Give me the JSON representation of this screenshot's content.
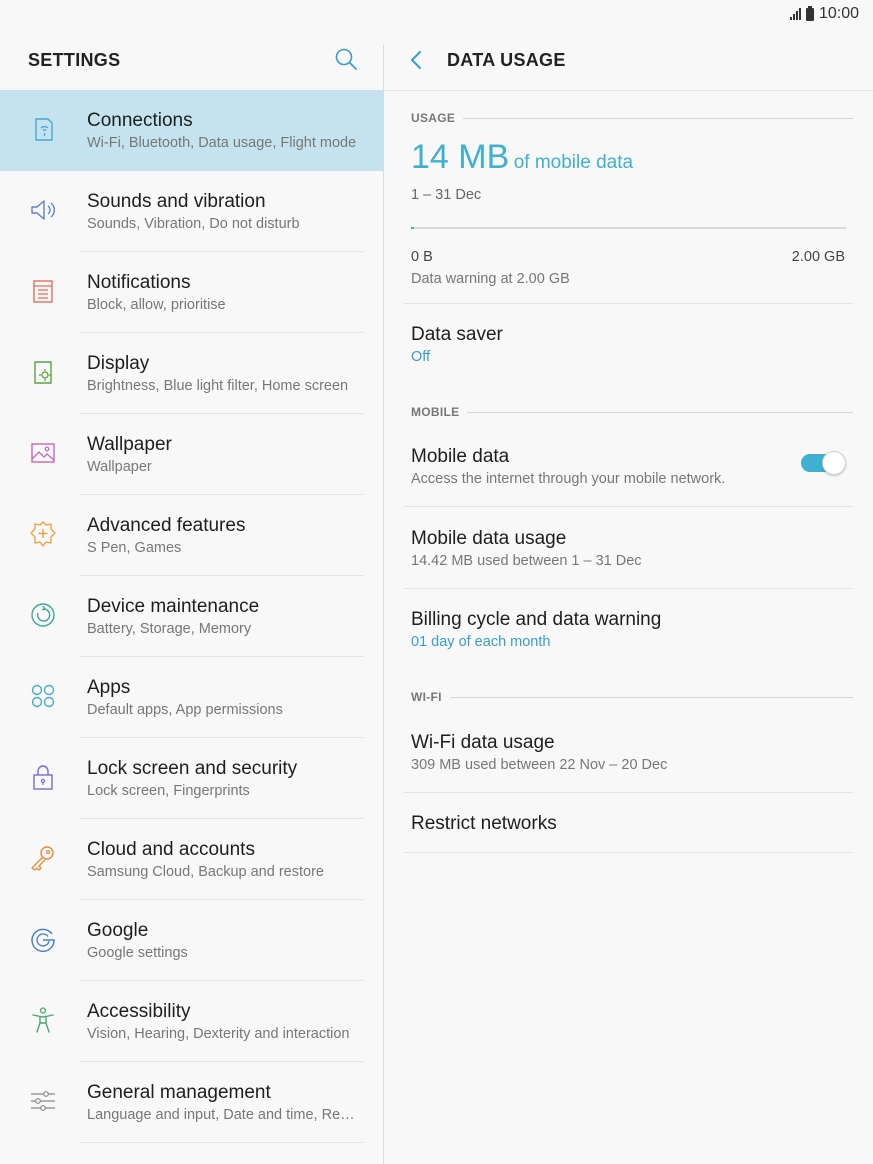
{
  "status_bar": {
    "time": "10:00"
  },
  "left": {
    "title": "SETTINGS",
    "items": [
      {
        "name": "connections",
        "label": "Connections",
        "sub": "Wi-Fi, Bluetooth, Data usage, Flight mode",
        "icon": "connections-icon",
        "active": true
      },
      {
        "name": "sounds-and-vibration",
        "label": "Sounds and vibration",
        "sub": "Sounds, Vibration, Do not disturb",
        "icon": "speaker-icon"
      },
      {
        "name": "notifications",
        "label": "Notifications",
        "sub": "Block, allow, prioritise",
        "icon": "notifications-icon"
      },
      {
        "name": "display",
        "label": "Display",
        "sub": "Brightness, Blue light filter, Home screen",
        "icon": "display-icon"
      },
      {
        "name": "wallpaper",
        "label": "Wallpaper",
        "sub": "Wallpaper",
        "icon": "wallpaper-icon"
      },
      {
        "name": "advanced-features",
        "label": "Advanced features",
        "sub": "S Pen, Games",
        "icon": "gear-plus-icon"
      },
      {
        "name": "device-maintenance",
        "label": "Device maintenance",
        "sub": "Battery, Storage, Memory",
        "icon": "maintenance-icon"
      },
      {
        "name": "apps",
        "label": "Apps",
        "sub": "Default apps, App permissions",
        "icon": "apps-icon"
      },
      {
        "name": "lock-screen-and-security",
        "label": "Lock screen and security",
        "sub": "Lock screen, Fingerprints",
        "icon": "lock-icon"
      },
      {
        "name": "cloud-and-accounts",
        "label": "Cloud and accounts",
        "sub": "Samsung Cloud, Backup and restore",
        "icon": "key-icon"
      },
      {
        "name": "google",
        "label": "Google",
        "sub": "Google settings",
        "icon": "google-icon"
      },
      {
        "name": "accessibility",
        "label": "Accessibility",
        "sub": "Vision, Hearing, Dexterity and interaction",
        "icon": "accessibility-icon"
      },
      {
        "name": "general-management",
        "label": "General management",
        "sub": "Language and input, Date and time, Res...",
        "icon": "sliders-icon"
      }
    ]
  },
  "right": {
    "title": "DATA USAGE",
    "usage_section": "USAGE",
    "usage_amount": "14 MB",
    "usage_suffix": "of mobile data",
    "usage_dates": "1 – 31 Dec",
    "usage_fraction": 0.007,
    "limit_min": "0 B",
    "limit_max": "2.00 GB",
    "warning_text": "Data warning at 2.00 GB",
    "data_saver": {
      "label": "Data saver",
      "value": "Off"
    },
    "mobile_section": "MOBILE",
    "mobile_data": {
      "label": "Mobile data",
      "sub": "Access the internet through your mobile network.",
      "enabled": true
    },
    "mobile_data_usage": {
      "label": "Mobile data usage",
      "sub": "14.42 MB used between 1 – 31 Dec"
    },
    "billing_cycle": {
      "label": "Billing cycle and data warning",
      "sub": "01 day of each month"
    },
    "wifi_section": "WI-FI",
    "wifi_data_usage": {
      "label": "Wi-Fi data usage",
      "sub": "309 MB used between 22 Nov – 20 Dec"
    },
    "restrict_networks": {
      "label": "Restrict networks"
    }
  },
  "colors": {
    "accent": "#3fb0d2",
    "selected_bg": "#c4e3ef"
  }
}
